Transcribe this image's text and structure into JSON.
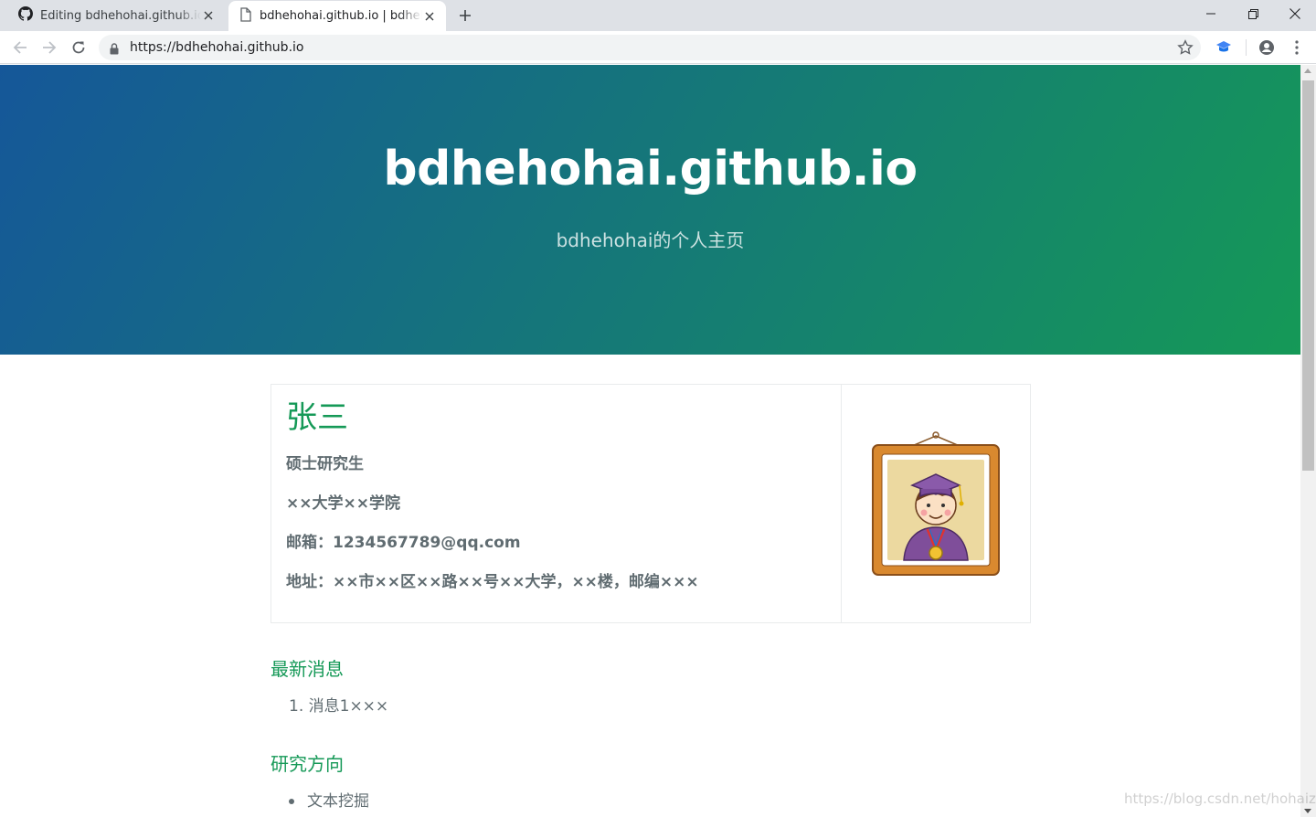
{
  "browser": {
    "tabs": [
      {
        "title": "Editing bdhehohai.github.io/index.md",
        "icon": "github-icon",
        "active": false
      },
      {
        "title": "bdhehohai.github.io | bdhehohai",
        "icon": "document-icon",
        "active": true
      }
    ],
    "url": "https://bdhehohai.github.io"
  },
  "header": {
    "title": "bdhehohai.github.io",
    "tagline": "bdhehohai的个人主页",
    "gradient": [
      "#155799",
      "#159957"
    ]
  },
  "profile": {
    "name": "张三",
    "degree": "硕士研究生",
    "school": "××大学××学院",
    "email": "邮箱：1234567789@qq.com",
    "address": "地址：××市××区××路××号××大学，××楼，邮编×××"
  },
  "sections": {
    "news_title": "最新消息",
    "news_items": [
      "1. 消息1×××"
    ],
    "research_title": "研究方向",
    "research_items": [
      "文本挖掘"
    ]
  },
  "watermark": "https://blog.csdn.net/hohaizx",
  "colors": {
    "accent": "#159957",
    "text": "#606c71"
  }
}
